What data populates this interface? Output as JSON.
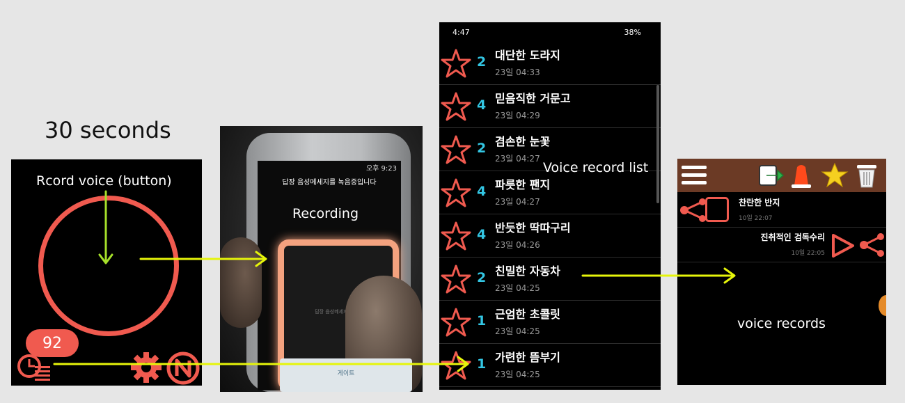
{
  "labels": {
    "duration": "30 seconds",
    "record_button": "Rcord voice (button)",
    "recording": "Recording",
    "record_list": "Voice record list",
    "voice_records": "voice records"
  },
  "recorder": {
    "counter": "92"
  },
  "photo": {
    "status_time": "오후 9:23",
    "title": "답장 음성메세지를 녹음중입니다",
    "pad_text": "답장 음성메세지 녹음중...",
    "bottom_text": "게이트"
  },
  "list_screen": {
    "status_time": "4:47",
    "status_right": "38%",
    "items": [
      {
        "num": "2",
        "title": "대단한 도라지",
        "date": "23일 04:33"
      },
      {
        "num": "4",
        "title": "믿음직한 거문고",
        "date": "23일 04:29"
      },
      {
        "num": "2",
        "title": "겸손한 눈꽃",
        "date": "23일 04:27"
      },
      {
        "num": "4",
        "title": "파릇한 팬지",
        "date": "23일 04:27"
      },
      {
        "num": "4",
        "title": "반듯한 딱따구리",
        "date": "23일 04:26"
      },
      {
        "num": "2",
        "title": "친밀한 자동차",
        "date": "23일 04:25"
      },
      {
        "num": "1",
        "title": "근엄한 초콜릿",
        "date": "23일 04:25"
      },
      {
        "num": "1",
        "title": "가련한 뜸부기",
        "date": "23일 04:25"
      }
    ]
  },
  "records_screen": {
    "items": [
      {
        "title": "찬란한 반지",
        "date": "10일 22:07"
      },
      {
        "title": "진취적인 검독수리",
        "date": "10일 22:05"
      }
    ]
  },
  "colors": {
    "accent_red": "#f05a4f",
    "arrow_yellow": "#e6f50a",
    "number_blue": "#33c6e3",
    "toolbar_brown": "#6b3a25"
  }
}
